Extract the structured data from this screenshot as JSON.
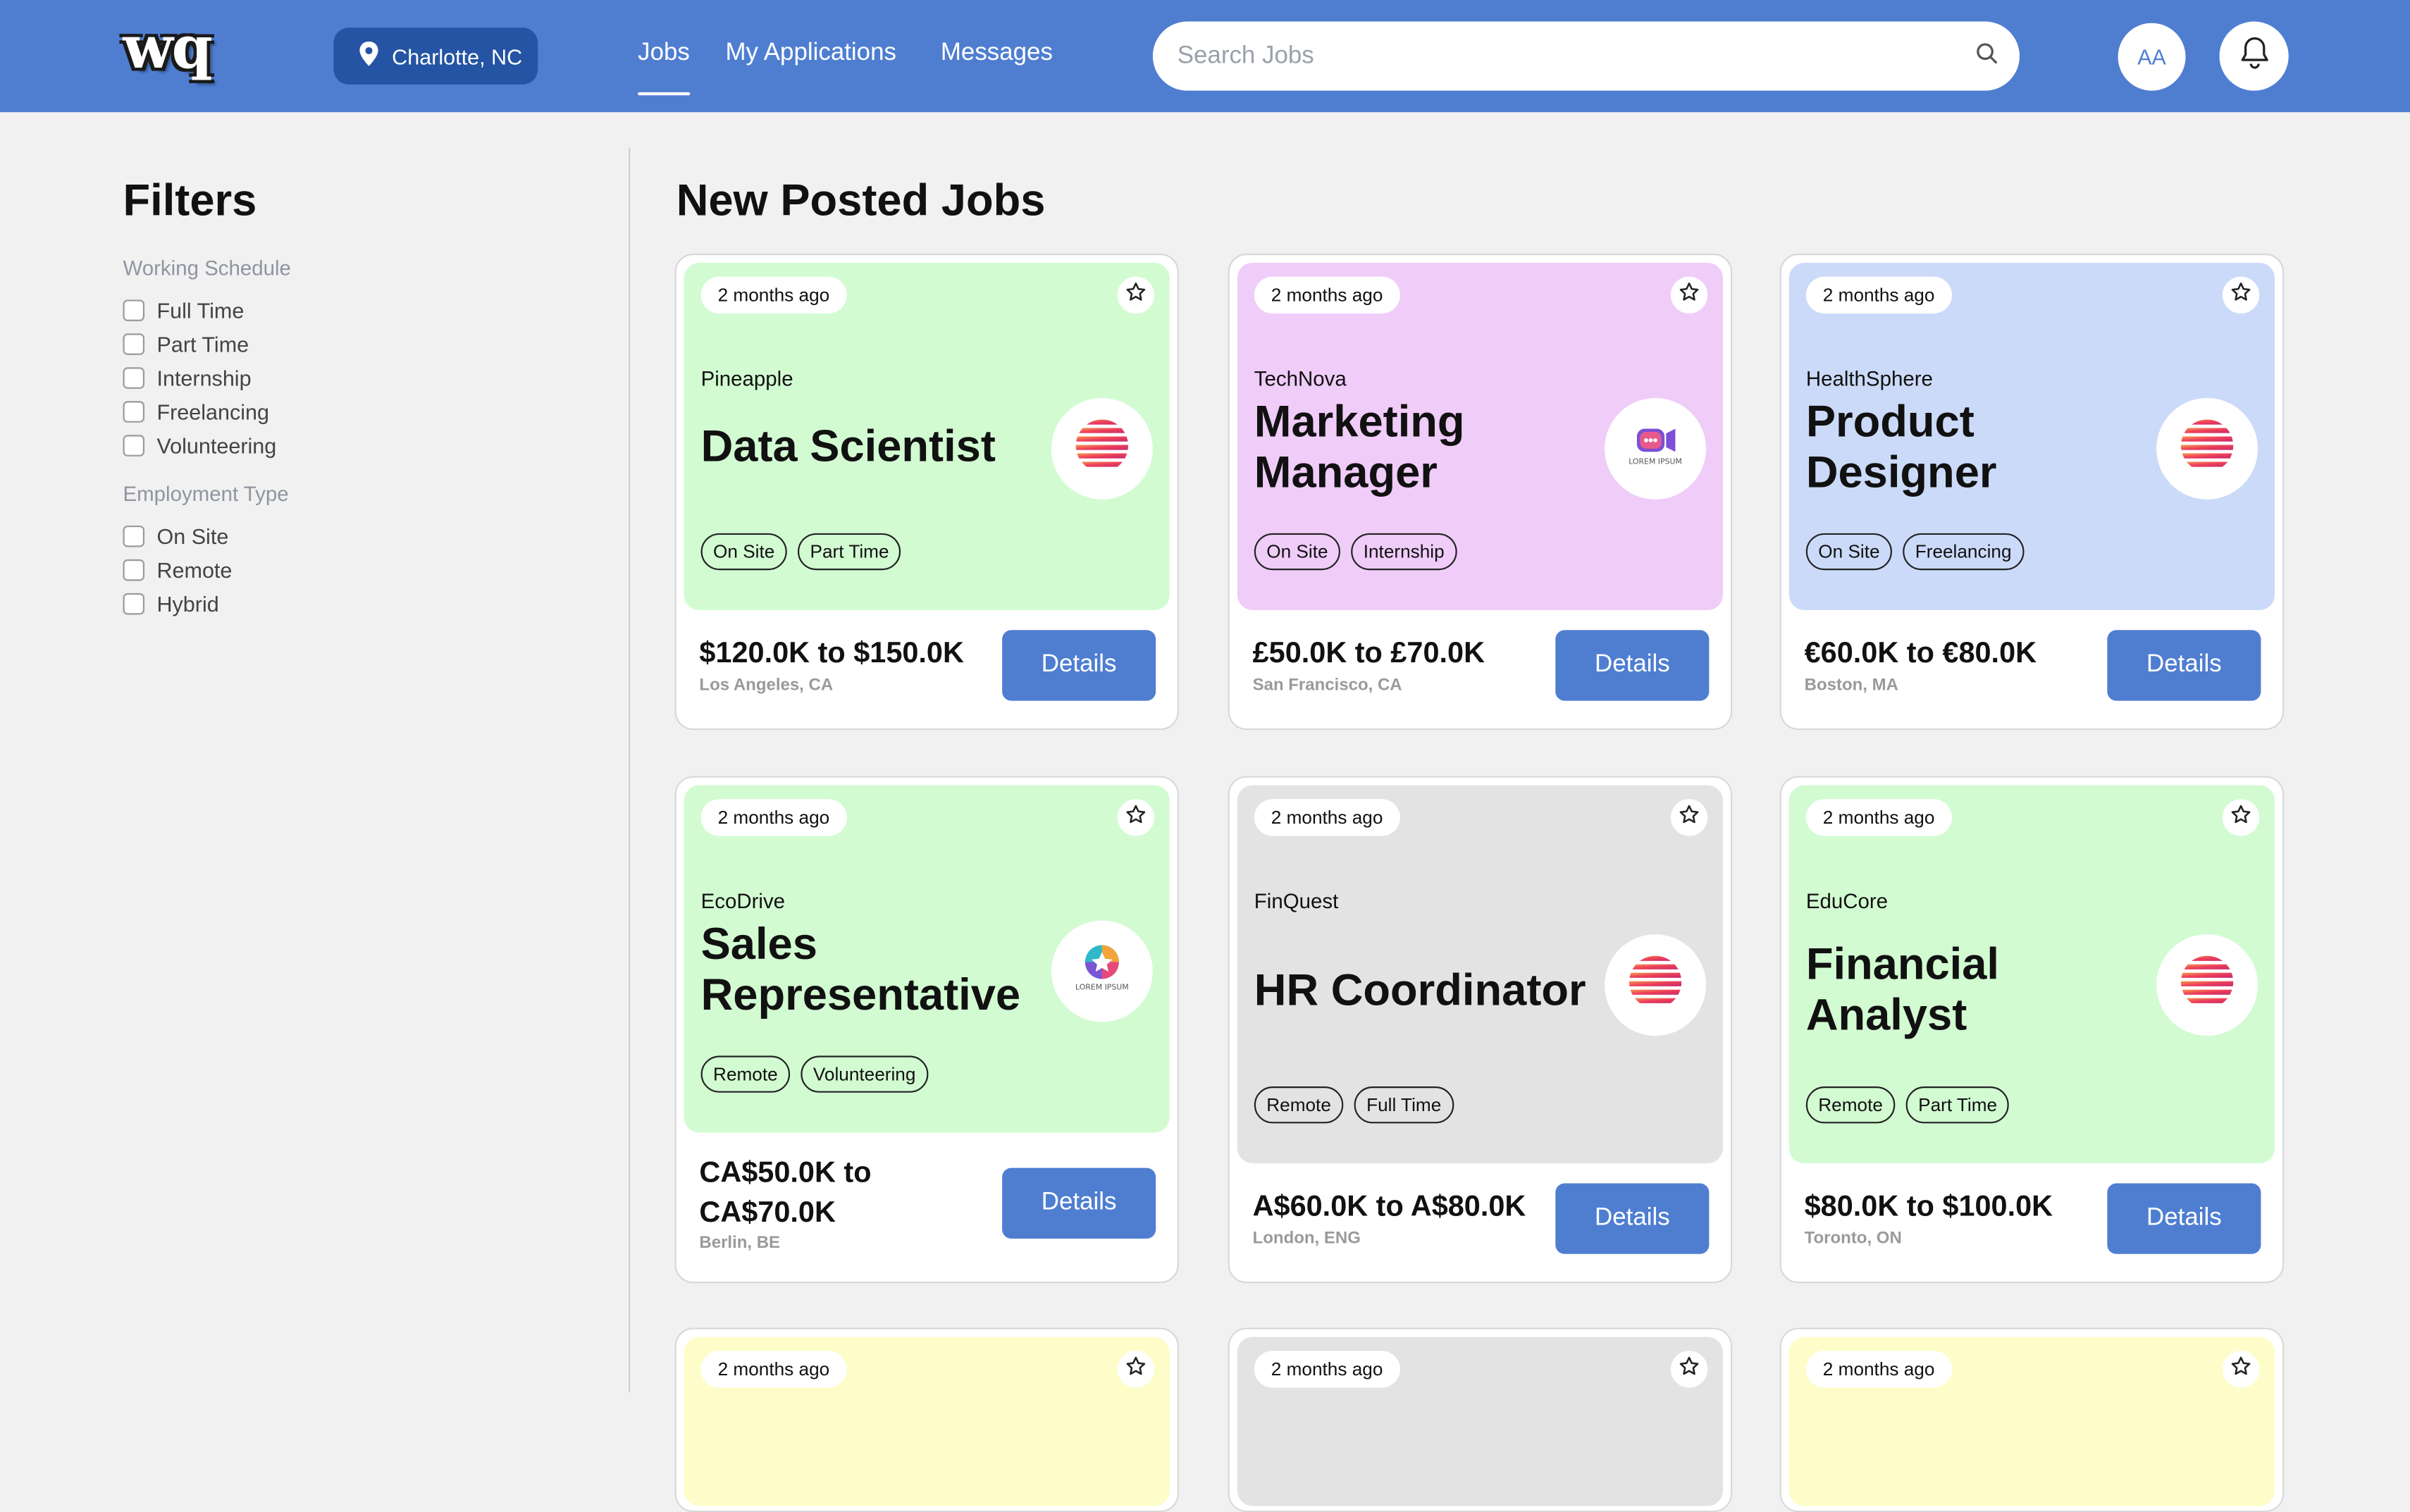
{
  "header": {
    "logo_text": "wq",
    "location": "Charlotte, NC",
    "nav": [
      "Jobs",
      "My Applications",
      "Messages"
    ],
    "active_nav": "Jobs",
    "search_placeholder": "Search Jobs",
    "avatar_initials": "AA"
  },
  "filters": {
    "title": "Filters",
    "working_schedule": {
      "title": "Working Schedule",
      "options": [
        "Full Time",
        "Part Time",
        "Internship",
        "Freelancing",
        "Volunteering"
      ]
    },
    "employment_type": {
      "title": "Employment Type",
      "options": [
        "On Site",
        "Remote",
        "Hybrid"
      ]
    }
  },
  "main": {
    "title": "New Posted Jobs",
    "details_label": "Details",
    "jobs": [
      {
        "posted": "2 months ago",
        "company": "Pineapple",
        "title": "Data Scientist",
        "tags": [
          "On Site",
          "Part Time"
        ],
        "salary": "$120.0K to $150.0K",
        "location": "Los Angeles, CA",
        "bg": "#d2fbd2",
        "logo": "striped-sphere-logo"
      },
      {
        "posted": "2 months ago",
        "company": "TechNova",
        "title": "Marketing Manager",
        "tags": [
          "On Site",
          "Internship"
        ],
        "salary": "£50.0K to £70.0K",
        "location": "San Francisco, CA",
        "bg": "#f0ccf9",
        "logo": "lorem-ipsum-camera-logo"
      },
      {
        "posted": "2 months ago",
        "company": "HealthSphere",
        "title": "Product Designer",
        "tags": [
          "On Site",
          "Freelancing"
        ],
        "salary": "€60.0K to €80.0K",
        "location": "Boston, MA",
        "bg": "#cbdaf8",
        "logo": "striped-sphere-logo"
      },
      {
        "posted": "2 months ago",
        "company": "EcoDrive",
        "title": "Sales Representative",
        "tags": [
          "Remote",
          "Volunteering"
        ],
        "salary": "CA$50.0K to CA$70.0K",
        "location": "Berlin, BE",
        "bg": "#d2fbd2",
        "logo": "lorem-ipsum-star-logo"
      },
      {
        "posted": "2 months ago",
        "company": "FinQuest",
        "title": "HR Coordinator",
        "tags": [
          "Remote",
          "Full Time"
        ],
        "salary": "A$60.0K to A$80.0K",
        "location": "London, ENG",
        "bg": "#e3e3e3",
        "logo": "striped-sphere-logo"
      },
      {
        "posted": "2 months ago",
        "company": "EduCore",
        "title": "Financial Analyst",
        "tags": [
          "Remote",
          "Part Time"
        ],
        "salary": "$80.0K to $100.0K",
        "location": "Toronto, ON",
        "bg": "#d2fbd2",
        "logo": "striped-sphere-logo"
      },
      {
        "posted": "2 months ago",
        "bg": "#fefdca"
      },
      {
        "posted": "2 months ago",
        "bg": "#e3e3e3"
      },
      {
        "posted": "2 months ago",
        "bg": "#fefdca"
      }
    ]
  },
  "colors": {
    "header_bg": "#4f7ed1",
    "location_button_bg": "#2454a3",
    "button_bg": "#4f7ed1",
    "page_bg": "#f1f1f1"
  }
}
